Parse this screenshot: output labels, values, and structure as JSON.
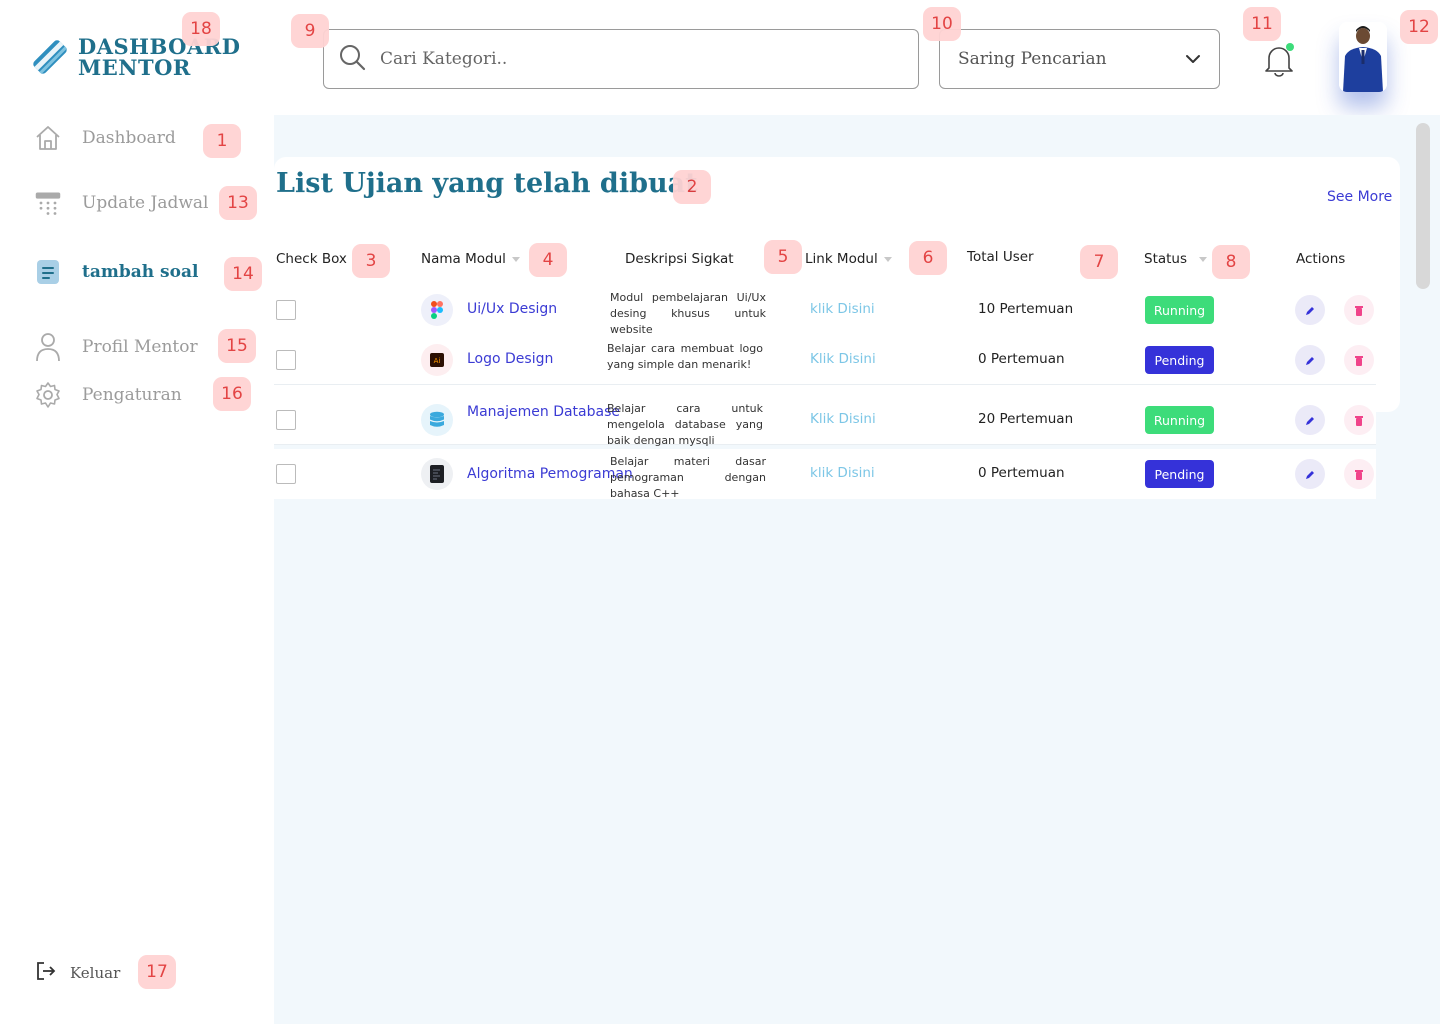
{
  "logo": {
    "line1": "DASHBOARD",
    "line2": "MENTOR"
  },
  "search": {
    "placeholder": "Cari Kategori.."
  },
  "filter": {
    "label": "Saring Pencarian"
  },
  "sidebar": {
    "items": [
      {
        "label": "Dashboard",
        "icon": "home-icon"
      },
      {
        "label": "Update Jadwal",
        "icon": "calendar-icon"
      },
      {
        "label": "tambah soal",
        "icon": "document-icon"
      },
      {
        "label": "Profil Mentor",
        "icon": "user-icon"
      },
      {
        "label": "Pengaturan",
        "icon": "gear-icon"
      }
    ],
    "logout": "Keluar"
  },
  "main": {
    "title": "List Ujian yang telah dibuat",
    "see_more": "See More",
    "columns": [
      "Check Box",
      "Nama Modul",
      "Deskripsi Sigkat",
      "Link Modul",
      "Total User",
      "Status",
      "Actions"
    ],
    "rows": [
      {
        "name": "Ui/Ux Design",
        "desc": "Modul pembelajaran Ui/Ux desing khusus untuk website",
        "link": "klik Disini",
        "total": "10 Pertemuan",
        "status": "Running",
        "icon": "figma-icon"
      },
      {
        "name": "Logo Design",
        "desc": "Belajar cara membuat logo yang simple dan menarik!",
        "link": "Klik Disini",
        "total": "0 Pertemuan",
        "status": "Pending",
        "icon": "illustrator-icon"
      },
      {
        "name": "Manajemen Database",
        "desc": "Belajar cara untuk mengelola database yang baik dengan mysqli",
        "link": "Klik Disini",
        "total": "20 Pertemuan",
        "status": "Running",
        "icon": "database-icon"
      },
      {
        "name": "Algoritma Pemograman",
        "desc": "Belajar materi dasar pemograman dengan bahasa C++",
        "link": "klik Disini",
        "total": "0 Pertemuan",
        "status": "Pending",
        "icon": "code-file-icon"
      }
    ]
  },
  "markers": [
    "1",
    "2",
    "3",
    "4",
    "5",
    "6",
    "7",
    "8",
    "9",
    "10",
    "11",
    "12",
    "13",
    "14",
    "15",
    "16",
    "17",
    "18"
  ],
  "colors": {
    "brand": "#1f6f8b",
    "running": "#3ddc7a",
    "pending": "#3532d9",
    "link": "#7cc6e6",
    "accent": "#3b3bd4"
  }
}
